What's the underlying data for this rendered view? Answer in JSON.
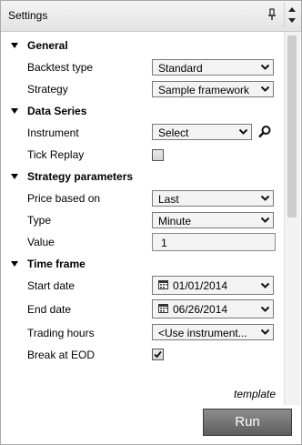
{
  "window": {
    "title": "Settings"
  },
  "sections": {
    "general": "General",
    "data_series": "Data Series",
    "strategy_parameters": "Strategy parameters",
    "time_frame": "Time frame"
  },
  "fields": {
    "backtest_type": {
      "label": "Backtest type",
      "value": "Standard"
    },
    "strategy": {
      "label": "Strategy",
      "value": "Sample framework"
    },
    "instrument": {
      "label": "Instrument",
      "value": "Select"
    },
    "tick_replay": {
      "label": "Tick Replay",
      "checked": false
    },
    "price_based_on": {
      "label": "Price based on",
      "value": "Last"
    },
    "type": {
      "label": "Type",
      "value": "Minute"
    },
    "value": {
      "label": "Value",
      "value": "1"
    },
    "start_date": {
      "label": "Start date",
      "value": "01/01/2014"
    },
    "end_date": {
      "label": "End date",
      "value": "06/26/2014"
    },
    "trading_hours": {
      "label": "Trading hours",
      "value": "<Use instrument..."
    },
    "break_at_eod": {
      "label": "Break at EOD",
      "checked": true
    }
  },
  "template_label": "template",
  "run_button": "Run",
  "icons": [
    "pin-icon",
    "scroll-up-icon",
    "scroll-down-icon",
    "section-collapse-icon",
    "dropdown-arrow-icon",
    "search-icon",
    "calendar-icon",
    "check-icon"
  ]
}
